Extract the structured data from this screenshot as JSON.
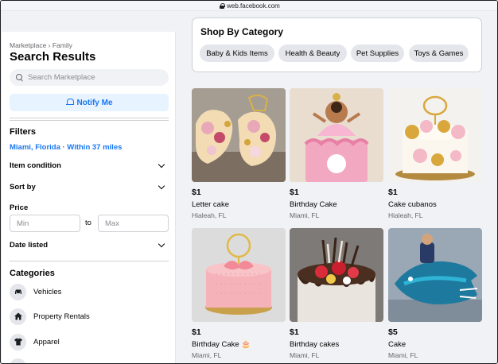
{
  "browser": {
    "url": "web.facebook.com"
  },
  "sidebar": {
    "breadcrumb": "Marketplace › Family",
    "title": "Search Results",
    "search_placeholder": "Search Marketplace",
    "notify_label": "Notify Me",
    "filters_heading": "Filters",
    "location": "Miami, Florida · Within 37 miles",
    "item_condition": "Item condition",
    "sort_by": "Sort by",
    "price_label": "Price",
    "price_min_placeholder": "Min",
    "price_to": "to",
    "price_max_placeholder": "Max",
    "date_listed": "Date listed",
    "categories_heading": "Categories",
    "categories": [
      {
        "label": "Vehicles",
        "icon": "car-icon"
      },
      {
        "label": "Property Rentals",
        "icon": "house-icon"
      },
      {
        "label": "Apparel",
        "icon": "shirt-icon"
      }
    ]
  },
  "shop_by_category": {
    "title": "Shop By Category",
    "chips": [
      "Baby & Kids Items",
      "Health & Beauty",
      "Pet Supplies",
      "Toys & Games"
    ]
  },
  "listings": [
    {
      "price": "$1",
      "title": "Letter cake",
      "location": "Hialeah, FL"
    },
    {
      "price": "$1",
      "title": "Birthday Cake",
      "location": "Miami, FL"
    },
    {
      "price": "$1",
      "title": "Cake cubanos",
      "location": "Hialeah, FL"
    },
    {
      "price": "$1",
      "title": "Birthday Cake 🎂",
      "location": "Miami, FL"
    },
    {
      "price": "$1",
      "title": "Birthday cakes",
      "location": "Miami, FL"
    },
    {
      "price": "$5",
      "title": "Cake",
      "location": "Miami, FL"
    }
  ],
  "colors": {
    "accent": "#1877f2",
    "accent_bg": "#e7f3ff",
    "page_bg": "#f0f2f5",
    "chip_bg": "#e4e6eb"
  }
}
